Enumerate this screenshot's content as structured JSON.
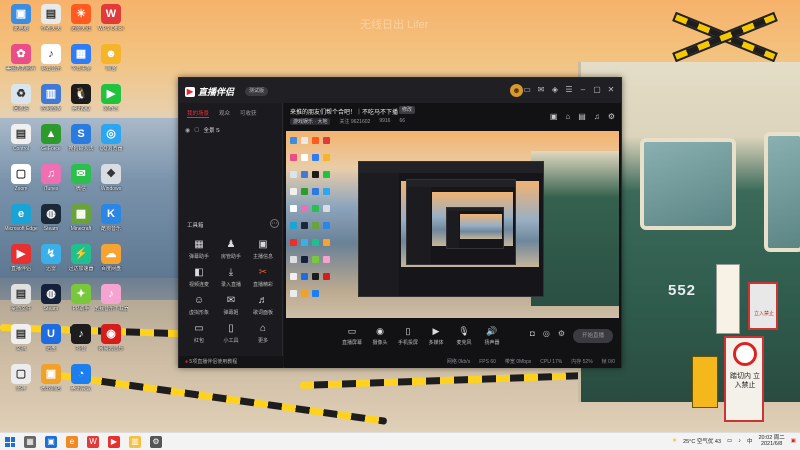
{
  "wallpaper": {
    "watermark": "无线日出 Lifer",
    "train_number": "552",
    "sign_text": "踏切内\n立入禁止",
    "sign3_text": "立入禁止",
    "side_marker": "3"
  },
  "desktop_icons": [
    {
      "label": "此电脑",
      "color": "#3a8de0",
      "glyph": "▣"
    },
    {
      "label": "作者天天",
      "color": "#e9e9e9",
      "glyph": "▤"
    },
    {
      "label": "迅雷天涯",
      "color": "#ff5a1f",
      "glyph": "☀"
    },
    {
      "label": "WPS Office",
      "color": "#e23a3a",
      "glyph": "W"
    },
    {
      "label": "美图秀秀照片",
      "color": "#e94f86",
      "glyph": "✿"
    },
    {
      "label": "易云音乐",
      "color": "#ffffff",
      "glyph": "♪"
    },
    {
      "label": "今日头条",
      "color": "#2e7cf6",
      "glyph": "▦"
    },
    {
      "label": "Wi客",
      "color": "#f4b52a",
      "glyph": "☻"
    },
    {
      "label": "回收站",
      "color": "#d8e4ee",
      "glyph": "♻"
    },
    {
      "label": "控制面板",
      "color": "#3f7bd6",
      "glyph": "▥"
    },
    {
      "label": "腾讯QQ",
      "color": "#1c1c1c",
      "glyph": "🐧"
    },
    {
      "label": "爱奇艺",
      "color": "#20c33e",
      "glyph": "▶"
    },
    {
      "label": "Control",
      "color": "#f0f0f0",
      "glyph": "▤"
    },
    {
      "label": "GeForce",
      "color": "#2c9b2c",
      "glyph": "▲"
    },
    {
      "label": "搜狗输入法",
      "color": "#2a7be0",
      "glyph": "S"
    },
    {
      "label": "QQ浏览器",
      "color": "#2ca6f0",
      "glyph": "◎"
    },
    {
      "label": "Zoom",
      "color": "#ffffff",
      "glyph": "▢"
    },
    {
      "label": "iTunes",
      "color": "#f06fb3",
      "glyph": "♫"
    },
    {
      "label": "微信",
      "color": "#2bc04b",
      "glyph": "✉"
    },
    {
      "label": "Windows",
      "color": "#d9dde2",
      "glyph": "❖"
    },
    {
      "label": "Microsoft Edge",
      "color": "#1aa4d6",
      "glyph": "e"
    },
    {
      "label": "Steam",
      "color": "#1b2838",
      "glyph": "◍"
    },
    {
      "label": "Minecraft",
      "color": "#6aa33b",
      "glyph": "▩"
    },
    {
      "label": "酷狗音乐",
      "color": "#2a87e6",
      "glyph": "K"
    },
    {
      "label": "直播伴侣",
      "color": "#e93030",
      "glyph": "▶"
    },
    {
      "label": "迅雷",
      "color": "#3bb0e8",
      "glyph": "↯"
    },
    {
      "label": "迅达加速器",
      "color": "#1fc08e",
      "glyph": "⚡"
    },
    {
      "label": "百度网盘",
      "color": "#f6a331",
      "glyph": "☁"
    },
    {
      "label": "桌面文件",
      "color": "#e0e0e0",
      "glyph": "▤"
    },
    {
      "label": "Steam",
      "color": "#15213a",
      "glyph": "◍"
    },
    {
      "label": "PP助手",
      "color": "#79c83b",
      "glyph": "✦"
    },
    {
      "label": "酷我音乐下载器",
      "color": "#f5a4d2",
      "glyph": "♪"
    },
    {
      "label": "文档",
      "color": "#f0f0f0",
      "glyph": "▤"
    },
    {
      "label": "迅盘",
      "color": "#1f6be0",
      "glyph": "U"
    },
    {
      "label": "抖音",
      "color": "#1c1c1c",
      "glyph": "♪"
    },
    {
      "label": "网易云音乐",
      "color": "#d71c1c",
      "glyph": "◉"
    },
    {
      "label": "雷神",
      "color": "#ececec",
      "glyph": "▢"
    },
    {
      "label": "微软商店",
      "color": "#f2a128",
      "glyph": "▣"
    },
    {
      "label": "腾讯会议",
      "color": "#1d7ef0",
      "glyph": "◔"
    }
  ],
  "window": {
    "app_name": "直播伴侣",
    "version_badge": "测试版",
    "tabs": [
      "我的场景",
      "观众",
      "可收获"
    ],
    "scene": "全景 S",
    "toolbox_title": "工具箱",
    "tools": [
      {
        "label": "弹幕助手",
        "glyph": "▦"
      },
      {
        "label": "房管助手",
        "glyph": "♟"
      },
      {
        "label": "主播信息",
        "glyph": "▣"
      },
      {
        "label": "视频连麦",
        "glyph": "◧"
      },
      {
        "label": "录入直播",
        "glyph": "⤓"
      },
      {
        "label": "直播精彩",
        "glyph": "✂",
        "hot": true
      },
      {
        "label": "虚拟形象",
        "glyph": "☺"
      },
      {
        "label": "弹幕姬",
        "glyph": "✉"
      },
      {
        "label": "歌词面板",
        "glyph": "♬"
      },
      {
        "label": "红包",
        "glyph": "▭"
      },
      {
        "label": "小工具",
        "glyph": "▯"
      },
      {
        "label": "更多",
        "glyph": "⌂"
      }
    ],
    "notice": "5项直播伴侣使用教程",
    "live_title": "来推的朋友们帮个合吧！｜不吃马不下播",
    "edit_label": "修改",
    "meta": {
      "category": "游戏娱乐 · 大地",
      "followers": "关注 9621602",
      "viewers": "9916",
      "likes": "66"
    },
    "controls": [
      {
        "label": "直播屏幕",
        "glyph": "▭"
      },
      {
        "label": "摄像头",
        "glyph": "◉"
      },
      {
        "label": "手机投屏",
        "glyph": "▯"
      },
      {
        "label": "多媒体",
        "glyph": "▶"
      },
      {
        "label": "麦克风",
        "glyph": "🎙"
      },
      {
        "label": "扬声器",
        "glyph": "🔊"
      }
    ],
    "go_live": "开始直播",
    "status": [
      "网络 0kb/s",
      "FPS 60",
      "带宽 0Mbps",
      "CPU 17%",
      "内存 52%",
      "帧 0/0"
    ]
  },
  "taskbar": {
    "weather": "25°C 空气优 43",
    "time": "20:02 周二",
    "date": "2021/6/8",
    "apps": [
      {
        "name": "start-menu",
        "color": "#1d6fd6",
        "glyph": ""
      },
      {
        "name": "task-view",
        "color": "#666",
        "glyph": "▦"
      },
      {
        "name": "widgets",
        "color": "#1d6fd6",
        "glyph": "▣"
      },
      {
        "name": "browser",
        "color": "#f08a24",
        "glyph": "e"
      },
      {
        "name": "wps",
        "color": "#e23a3a",
        "glyph": "W"
      },
      {
        "name": "live-companion",
        "color": "#e93030",
        "glyph": "▶"
      },
      {
        "name": "explorer",
        "color": "#f6c143",
        "glyph": "▥"
      },
      {
        "name": "settings",
        "color": "#555",
        "glyph": "⚙"
      }
    ]
  }
}
